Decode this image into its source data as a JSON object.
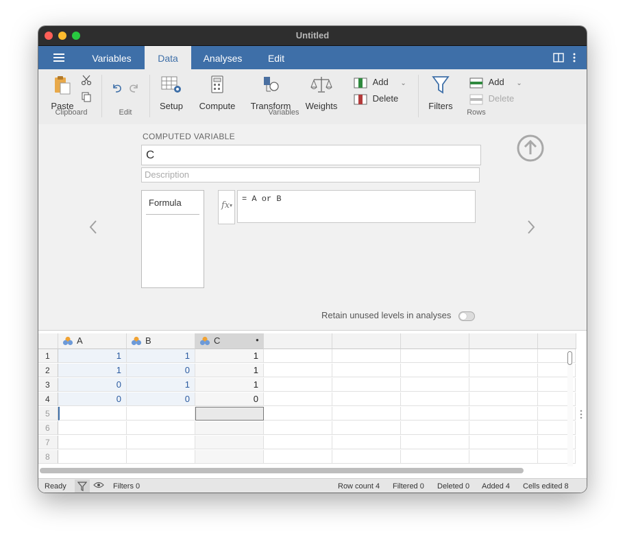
{
  "window": {
    "title": "Untitled"
  },
  "menu": {
    "tabs": [
      {
        "label": "Variables"
      },
      {
        "label": "Data"
      },
      {
        "label": "Analyses"
      },
      {
        "label": "Edit"
      }
    ],
    "active_tab": "Data"
  },
  "ribbon": {
    "paste": "Paste",
    "clipboard": "Clipboard",
    "edit": "Edit",
    "setup": "Setup",
    "compute": "Compute",
    "transform": "Transform",
    "weights": "Weights",
    "add_var": "Add",
    "delete_var": "Delete",
    "variables": "Variables",
    "filters": "Filters",
    "add_row": "Add",
    "delete_row": "Delete",
    "rows": "Rows"
  },
  "editor": {
    "section_title": "COMPUTED VARIABLE",
    "name": "C",
    "description_placeholder": "Description",
    "list_item": "Formula",
    "fx_label": "fx",
    "formula": "= A or B",
    "retain_label": "Retain unused levels in analyses",
    "retain_on": false
  },
  "grid": {
    "columns": [
      "A",
      "B",
      "C"
    ],
    "row_numbers": [
      "1",
      "2",
      "3",
      "4",
      "5",
      "6",
      "7",
      "8"
    ],
    "rows": [
      [
        "1",
        "1",
        "1"
      ],
      [
        "1",
        "0",
        "1"
      ],
      [
        "0",
        "1",
        "1"
      ],
      [
        "0",
        "0",
        "0"
      ]
    ]
  },
  "status": {
    "ready": "Ready",
    "filters": "Filters 0",
    "row_count": "Row count 4",
    "filtered": "Filtered 0",
    "deleted": "Deleted 0",
    "added": "Added 4",
    "cells_edited": "Cells edited 8"
  },
  "colors": {
    "accent": "#3e6fa8",
    "value_text": "#2a5aa0",
    "data_cell_bg": "#eef3f9"
  }
}
